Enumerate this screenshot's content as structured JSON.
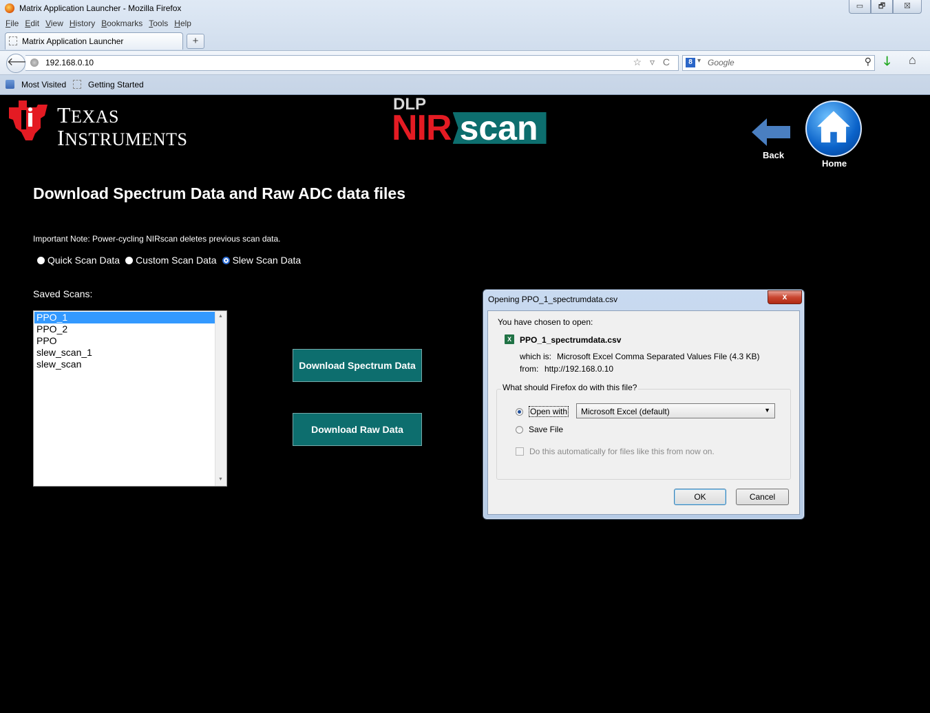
{
  "window": {
    "title": "Matrix Application Launcher - Mozilla Firefox",
    "controls": [
      "▭",
      "🗗",
      "☒"
    ]
  },
  "menu": [
    "File",
    "Edit",
    "View",
    "History",
    "Bookmarks",
    "Tools",
    "Help"
  ],
  "tab": {
    "label": "Matrix Application Launcher",
    "new_tab": "+"
  },
  "navbar": {
    "back": "🡐",
    "url": "192.168.0.10",
    "url_tools": "☆ ▿ C",
    "search_engine_icon": "8",
    "search_placeholder": "Google",
    "search_icon": "⚲",
    "download_icon": "🡓",
    "home_icon": "⌂"
  },
  "bookmarks": [
    "Most Visited",
    "Getting Started"
  ],
  "page": {
    "ti_line1_big": "T",
    "ti_line1_rest": "EXAS",
    "ti_line2_big": "I",
    "ti_line2_rest": "NSTRUMENTS",
    "dlp": "DLP",
    "nir": "NIR",
    "scan": "scan",
    "back_label": "Back",
    "home_label": "Home",
    "title": "Download Spectrum Data and Raw ADC data files",
    "note": "Important Note: Power-cycling NIRscan deletes previous scan data.",
    "radios": [
      {
        "label": "Quick Scan Data",
        "selected": false
      },
      {
        "label": "Custom Scan Data",
        "selected": false
      },
      {
        "label": "Slew Scan Data",
        "selected": true
      }
    ],
    "saved_label": "Saved Scans:",
    "saved_scans": [
      "PPO_1",
      "PPO_2",
      "PPO",
      "slew_scan_1",
      "slew_scan"
    ],
    "selected_scan": "PPO_1",
    "btn_spectrum": "Download Spectrum Data",
    "btn_raw": "Download Raw Data",
    "accent_teal": "#0d6e6e"
  },
  "dialog": {
    "title": "Opening PPO_1_spectrumdata.csv",
    "close": "x",
    "chosen": "You have chosen to open:",
    "file_icon": "X",
    "file": "PPO_1_spectrumdata.csv",
    "which_is_label": "which is:",
    "which_is_value": "Microsoft Excel Comma Separated Values File (4.3 KB)",
    "from_label": "from:",
    "from_value": "http://192.168.0.10",
    "question": "What should Firefox do with this file?",
    "open_with_label": "Open with",
    "open_with_app": "Microsoft Excel (default)",
    "save_file_label": "Save File",
    "auto_label": "Do this automatically for files like this from now on.",
    "ok": "OK",
    "cancel": "Cancel"
  }
}
